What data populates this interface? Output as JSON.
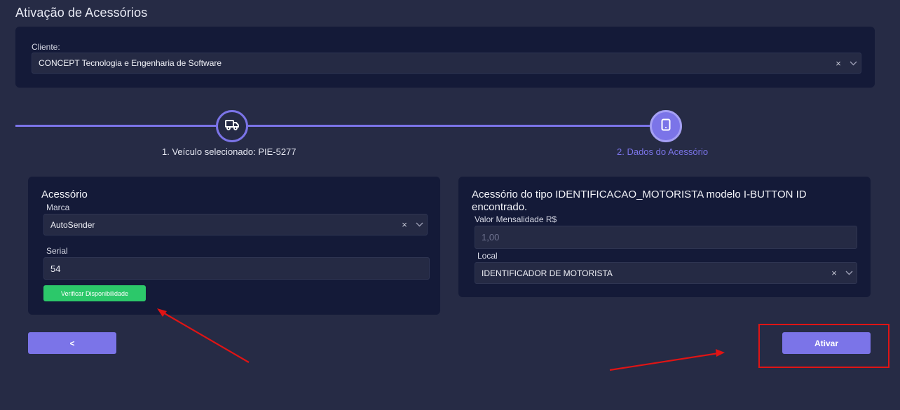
{
  "page": {
    "title": "Ativação de Acessórios"
  },
  "client": {
    "label": "Cliente:",
    "value": "CONCEPT Tecnologia e Engenharia de Software",
    "clear_glyph": "×"
  },
  "stepper": {
    "steps": [
      {
        "label": "1. Veículo selecionado: PIE-5277",
        "icon": "truck-icon",
        "state": "completed"
      },
      {
        "label": "2. Dados do Acessório",
        "icon": "tablet-icon",
        "state": "active"
      }
    ]
  },
  "accessory": {
    "title": "Acessório",
    "brand_label": "Marca",
    "brand_value": "AutoSender",
    "brand_clear_glyph": "×",
    "serial_label": "Serial",
    "serial_value": "54",
    "verify_button": "Verificar Disponibilidade"
  },
  "info": {
    "title": "Acessório do tipo IDENTIFICACAO_MOTORISTA modelo I-BUTTON ID encontrado.",
    "price_label": "Valor Mensalidade R$",
    "price_value": "1,00",
    "local_label": "Local",
    "local_value": "IDENTIFICADOR DE MOTORISTA",
    "local_clear_glyph": "×"
  },
  "footer": {
    "back_button": "<",
    "activate_button": "Ativar"
  },
  "colors": {
    "background": "#262b45",
    "card": "#141a38",
    "accent": "#7b74e8",
    "success": "#2cc86a",
    "annotation": "#e01414"
  }
}
